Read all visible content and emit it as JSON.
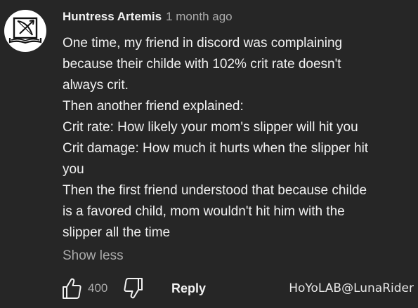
{
  "comment": {
    "author": "Huntress Artemis",
    "timestamp": "1 month ago",
    "avatar_icon": "book-bow-icon",
    "lines": [
      "One time, my friend in discord was complaining",
      "because their childe with 102% crit rate doesn't",
      "always crit.",
      "Then another friend explained:",
      "Crit rate: How likely your mom's slipper will hit you",
      "Crit damage: How much it hurts when the slipper hit",
      "you",
      "Then the first friend understood that because childe",
      "is a favored child, mom wouldn't hit him with the",
      "slipper all the time"
    ],
    "show_less_label": "Show less",
    "like_count": "400",
    "reply_label": "Reply"
  },
  "watermark": "HoYoLAB@LunaRider",
  "colors": {
    "background": "#262626",
    "primary_text": "#f1f1f1",
    "secondary_text": "#aaaaaa"
  }
}
